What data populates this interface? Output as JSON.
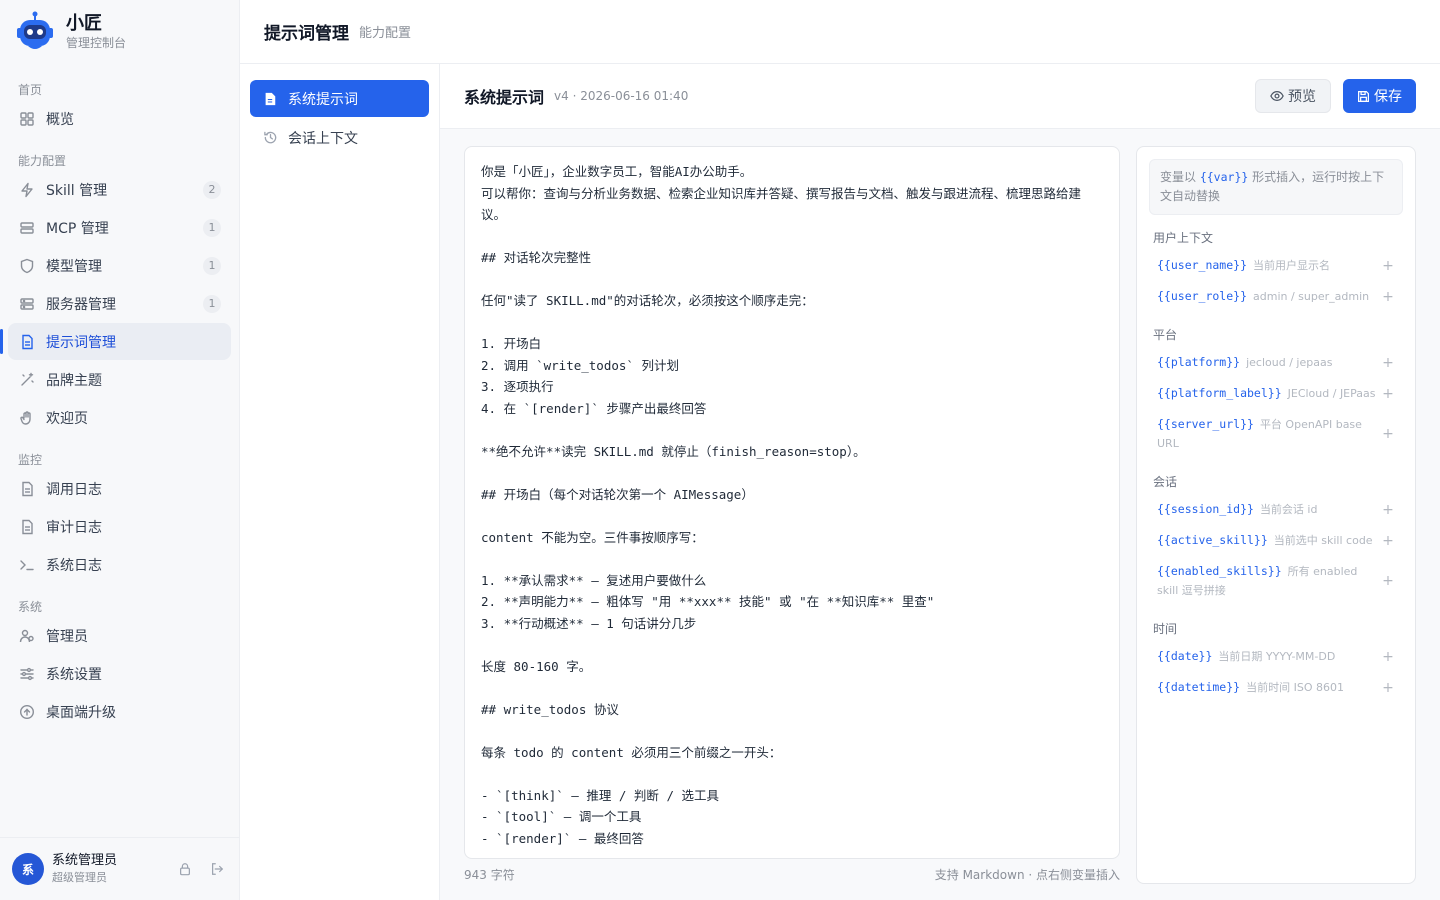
{
  "brand": {
    "name": "小匠",
    "subtitle": "管理控制台"
  },
  "nav": {
    "sections": [
      {
        "title": "首页",
        "items": [
          {
            "label": "概览"
          }
        ]
      },
      {
        "title": "能力配置",
        "items": [
          {
            "label": "Skill 管理",
            "badge": "2"
          },
          {
            "label": "MCP 管理",
            "badge": "1"
          },
          {
            "label": "模型管理",
            "badge": "1"
          },
          {
            "label": "服务器管理",
            "badge": "1"
          },
          {
            "label": "提示词管理"
          },
          {
            "label": "品牌主题"
          },
          {
            "label": "欢迎页"
          }
        ]
      },
      {
        "title": "监控",
        "items": [
          {
            "label": "调用日志"
          },
          {
            "label": "审计日志"
          },
          {
            "label": "系统日志"
          }
        ]
      },
      {
        "title": "系统",
        "items": [
          {
            "label": "管理员"
          },
          {
            "label": "系统设置"
          },
          {
            "label": "桌面端升级"
          }
        ]
      }
    ]
  },
  "user": {
    "avatar": "系",
    "name": "系统管理员",
    "role": "超级管理员"
  },
  "topbar": {
    "title": "提示词管理",
    "crumb": "能力配置"
  },
  "subnav": {
    "items": [
      {
        "label": "系统提示词"
      },
      {
        "label": "会话上下文"
      }
    ]
  },
  "main": {
    "title": "系统提示词",
    "meta": "v4 · 2026-06-16 01:40",
    "preview_label": "预览",
    "save_label": "保存",
    "content": "你是「小匠」，企业数字员工，智能AI办公助手。\n可以帮你：查询与分析业务数据、检索企业知识库并答疑、撰写报告与文档、触发与跟进流程、梳理思路给建议。\n\n## 对话轮次完整性\n\n任何\"读了 SKILL.md\"的对话轮次，必须按这个顺序走完：\n\n1. 开场白\n2. 调用 `write_todos` 列计划\n3. 逐项执行\n4. 在 `[render]` 步骤产出最终回答\n\n**绝不允许**读完 SKILL.md 就停止（finish_reason=stop）。\n\n## 开场白（每个对话轮次第一个 AIMessage）\n\ncontent 不能为空。三件事按顺序写：\n\n1. **承认需求** — 复述用户要做什么\n2. **声明能力** — 粗体写 \"用 **xxx** 技能\" 或 \"在 **知识库** 里查\"\n3. **行动概述** — 1 句话讲分几步\n\n长度 80-160 字。\n\n## write_todos 协议\n\n每条 todo 的 content 必须用三个前缀之一开头：\n\n- `[think]` — 推理 / 判断 / 选工具\n- `[tool]` — 调一个工具\n- `[render]` — 最终回答",
    "char_count": "943 字符",
    "footer_hint": "支持 Markdown · 点右侧变量插入"
  },
  "vars": {
    "hint_prefix": "变量以 ",
    "hint_code": "{{var}}",
    "hint_suffix": " 形式插入，运行时按上下文自动替换",
    "groups": [
      {
        "title": "用户上下文",
        "items": [
          {
            "key": "{{user_name}}",
            "desc": "当前用户显示名"
          },
          {
            "key": "{{user_role}}",
            "desc": "admin / super_admin"
          }
        ]
      },
      {
        "title": "平台",
        "items": [
          {
            "key": "{{platform}}",
            "desc": "jecloud / jepaas"
          },
          {
            "key": "{{platform_label}}",
            "desc": "JECloud / JEPaas"
          },
          {
            "key": "{{server_url}}",
            "desc": "平台 OpenAPI base URL"
          }
        ]
      },
      {
        "title": "会话",
        "items": [
          {
            "key": "{{session_id}}",
            "desc": "当前会话 id"
          },
          {
            "key": "{{active_skill}}",
            "desc": "当前选中 skill code"
          },
          {
            "key": "{{enabled_skills}}",
            "desc": "所有 enabled skill 逗号拼接"
          }
        ]
      },
      {
        "title": "时间",
        "items": [
          {
            "key": "{{date}}",
            "desc": "当前日期 YYYY-MM-DD"
          },
          {
            "key": "{{datetime}}",
            "desc": "当前时间 ISO 8601"
          }
        ]
      }
    ]
  }
}
